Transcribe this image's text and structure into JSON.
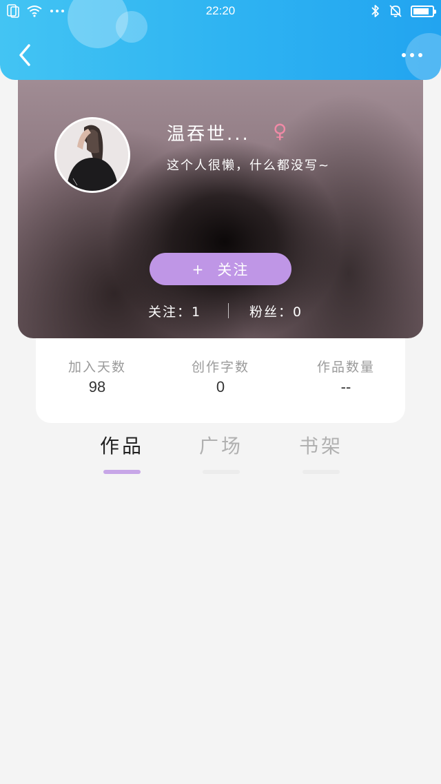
{
  "status_bar": {
    "time": "22:20",
    "battery_level": 0.85,
    "icons": [
      "sim-card-icon",
      "wifi-icon",
      "more-dots-icon",
      "bluetooth-icon",
      "bell-mute-icon",
      "battery-icon"
    ]
  },
  "header": {
    "background_color": "#2fb4f2",
    "back_icon": "back-chevron-icon",
    "menu_icon": "more-horizontal-icon"
  },
  "profile": {
    "nickname": "温吞世...",
    "gender_symbol": "♀",
    "bio": "这个人很懒，什么都没写~",
    "follow_button": {
      "plus": "+",
      "label": "关注",
      "color": "#bf96e6"
    },
    "following_text": "关注：1",
    "fans_text": "粉丝：0"
  },
  "stats": [
    {
      "label": "加入天数",
      "value": "98"
    },
    {
      "label": "创作字数",
      "value": "0"
    },
    {
      "label": "作品数量",
      "value": "--"
    }
  ],
  "tabs": [
    {
      "label": "作品",
      "active": true
    },
    {
      "label": "广场",
      "active": false
    },
    {
      "label": "书架",
      "active": false
    }
  ],
  "accent_color": "#c7a6e7"
}
